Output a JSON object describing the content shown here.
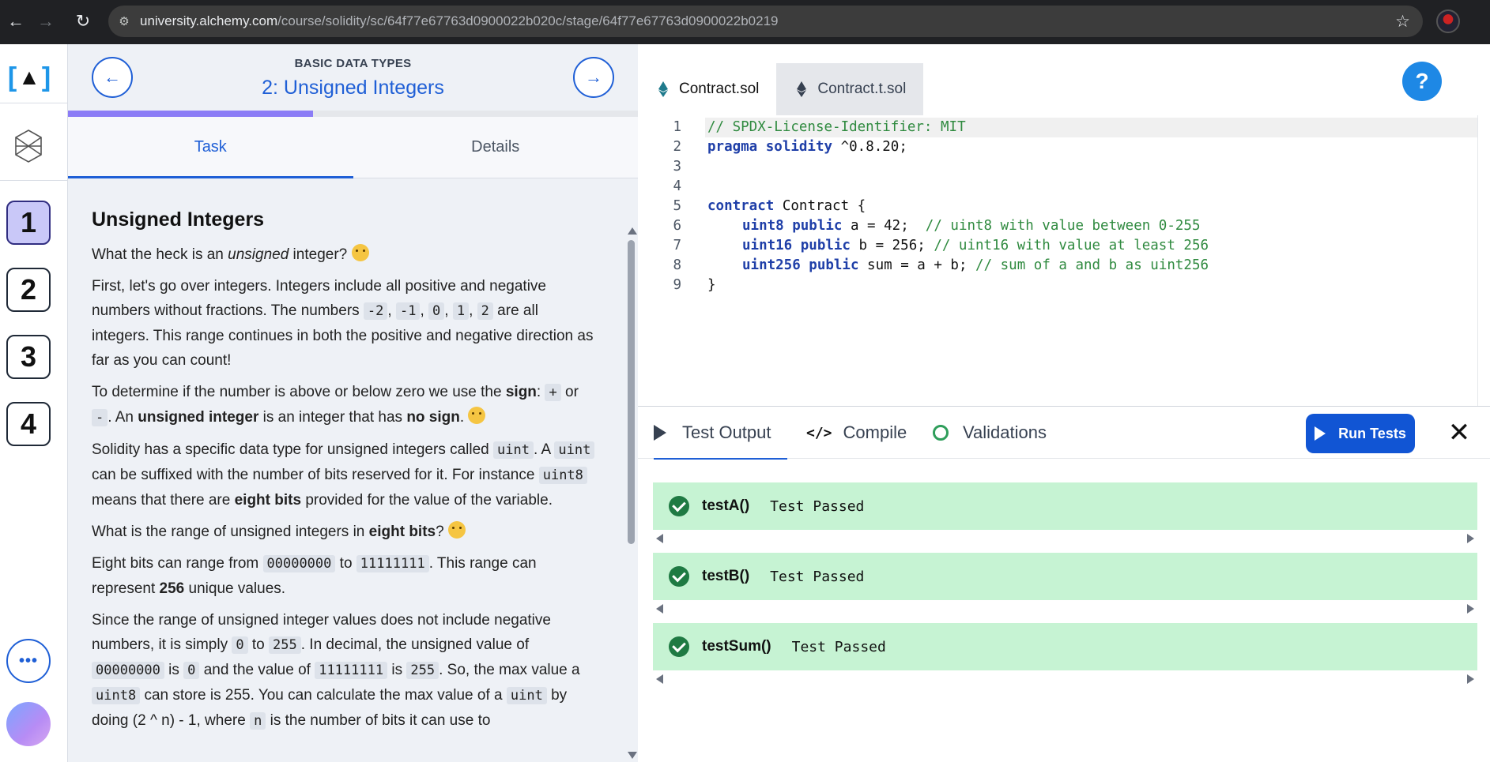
{
  "browser": {
    "url_host": "university.alchemy.com",
    "url_path": "/course/solidity/sc/64f77e67763d0900022b020c/stage/64f77e67763d0900022b0219"
  },
  "rail": {
    "stages": [
      "1",
      "2",
      "3",
      "4"
    ],
    "more_label": "•••"
  },
  "lesson": {
    "section": "BASIC DATA TYPES",
    "title": "2: Unsigned Integers",
    "progress_fraction": 0.43,
    "tabs": [
      "Task",
      "Details"
    ],
    "heading": "Unsigned Integers",
    "p1": {
      "a": "What the heck is an ",
      "b": "unsigned",
      "c": " integer?"
    },
    "p2": {
      "a": "First, let's go over integers. Integers include all positive and negative numbers without fractions. The numbers ",
      "c1": "-2",
      "c2": "-1",
      "c3": "0",
      "c4": "1",
      "c5": "2",
      "b": " are all integers. This range continues in both the positive and negative direction as far as you can count!"
    },
    "p3": {
      "a": "To determine if the number is above or below zero we use the ",
      "b": "sign",
      "c1": "+",
      "d": " or ",
      "c2": "-",
      "e": ". An ",
      "f": "unsigned integer",
      "g": " is an integer that has ",
      "h": "no sign",
      "i": "."
    },
    "p4": {
      "a": "Solidity has a specific data type for unsigned integers called ",
      "c1": "uint",
      "b": ". A ",
      "c2": "uint",
      "d": " can be suffixed with the number of bits reserved for it. For instance ",
      "c3": "uint8",
      "e": " means that there are ",
      "f": "eight bits",
      "g": " provided for the value of the variable."
    },
    "p5": {
      "a": "What is the range of unsigned integers in ",
      "b": "eight bits",
      "c": "?"
    },
    "p6": {
      "a": "Eight bits can range from ",
      "c1": "00000000",
      "b": " to ",
      "c2": "11111111",
      "d": ". This range can represent ",
      "e": "256",
      "f": " unique values."
    },
    "p7": {
      "a": "Since the range of unsigned integer values does not include negative numbers, it is simply ",
      "c1": "0",
      "b": " to ",
      "c2": "255",
      "d": ". In decimal, the unsigned value of ",
      "c3": "00000000",
      "e": " is ",
      "c4": "0",
      "f": " and the value of ",
      "c5": "11111111",
      "g": " is ",
      "c6": "255",
      "h": ". So, the max value a ",
      "c7": "uint8",
      "i": " can store is 255. You can calculate the max value of a ",
      "c8": "uint",
      "j": " by doing (2 ^ n) - 1, where ",
      "c9": "n",
      "k": " is the number of bits it can use to"
    }
  },
  "editor": {
    "files": [
      "Contract.sol",
      "Contract.t.sol"
    ],
    "help_label": "?",
    "lines": [
      {
        "n": "1"
      },
      {
        "n": "2"
      },
      {
        "n": "3"
      },
      {
        "n": "4"
      },
      {
        "n": "5"
      },
      {
        "n": "6"
      },
      {
        "n": "7"
      },
      {
        "n": "8"
      },
      {
        "n": "9"
      }
    ],
    "code": {
      "l1": "// SPDX-License-Identifier: MIT",
      "l2_kw": "pragma solidity",
      "l2_rest": " ^0.8.20;",
      "l5_kw": "contract",
      "l5_rest": " Contract {",
      "l6_kw": "uint8 public",
      "l6_rest": " a = 42;  ",
      "l6_cm": "// uint8 with value between 0-255",
      "l7_kw": "uint16 public",
      "l7_rest": " b = 256; ",
      "l7_cm": "// uint16 with value at least 256",
      "l8_kw": "uint256 public",
      "l8_rest": " sum = a + b; ",
      "l8_cm": "// sum of a and b as uint256",
      "l9": "}"
    }
  },
  "output": {
    "tabs": [
      "Test Output",
      "Compile",
      "Validations"
    ],
    "run_label": "Run Tests",
    "close_label": "✕",
    "tests": [
      {
        "name": "testA()",
        "result": "Test Passed"
      },
      {
        "name": "testB()",
        "result": "Test Passed"
      },
      {
        "name": "testSum()",
        "result": "Test Passed"
      }
    ]
  },
  "colors": {
    "accent": "#1f5fd6",
    "progress": "#8b7cf6",
    "pass_bg": "#c6f3d3",
    "pass_icon": "#1f7a43"
  }
}
